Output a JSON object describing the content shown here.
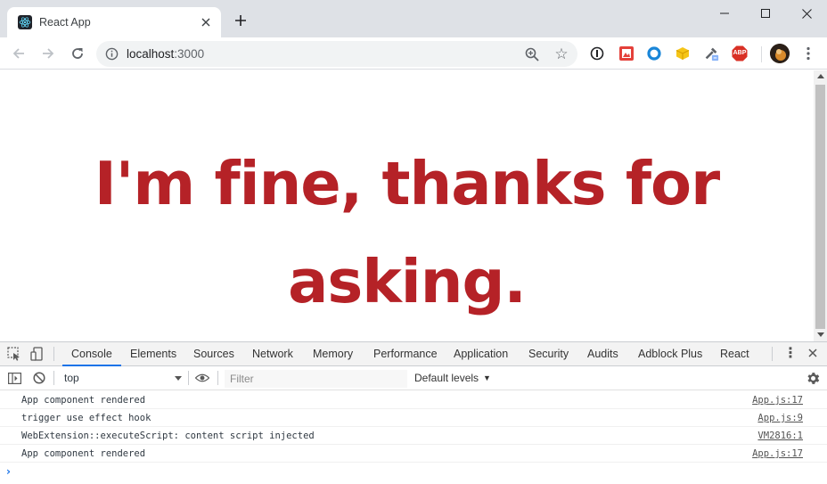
{
  "browser": {
    "tab_title": "React App",
    "url_host": "localhost",
    "url_port": ":3000",
    "extensions": [
      "info-icon",
      "image-extension-icon",
      "ring-extension-icon",
      "cube-extension-icon",
      "eyedropper-extension-icon",
      "adblock-plus-icon"
    ],
    "adblock_label": "ABP",
    "colors": {
      "tab_strip": "#dee1e6",
      "omnibox": "#f1f3f4"
    }
  },
  "page": {
    "heading_line1": "I'm fine, thanks for",
    "heading_line2": "asking.",
    "heading_color": "#b52227"
  },
  "devtools": {
    "tabs": [
      {
        "label": "Console",
        "active": true
      },
      {
        "label": "Elements"
      },
      {
        "label": "Sources"
      },
      {
        "label": "Network"
      },
      {
        "label": "Memory"
      },
      {
        "label": "Performance"
      },
      {
        "label": "Application"
      },
      {
        "label": "Security"
      },
      {
        "label": "Audits"
      },
      {
        "label": "Adblock Plus"
      },
      {
        "label": "React"
      }
    ],
    "context": "top",
    "filter_placeholder": "Filter",
    "levels_label": "Default levels",
    "accent_color": "#1a73e8",
    "messages": [
      {
        "text": "App component rendered",
        "source": "App.js:17"
      },
      {
        "text": "trigger use effect hook",
        "source": "App.js:9"
      },
      {
        "text": "WebExtension::executeScript: content script injected",
        "source": "VM2816:1"
      },
      {
        "text": "App component rendered",
        "source": "App.js:17"
      }
    ]
  }
}
